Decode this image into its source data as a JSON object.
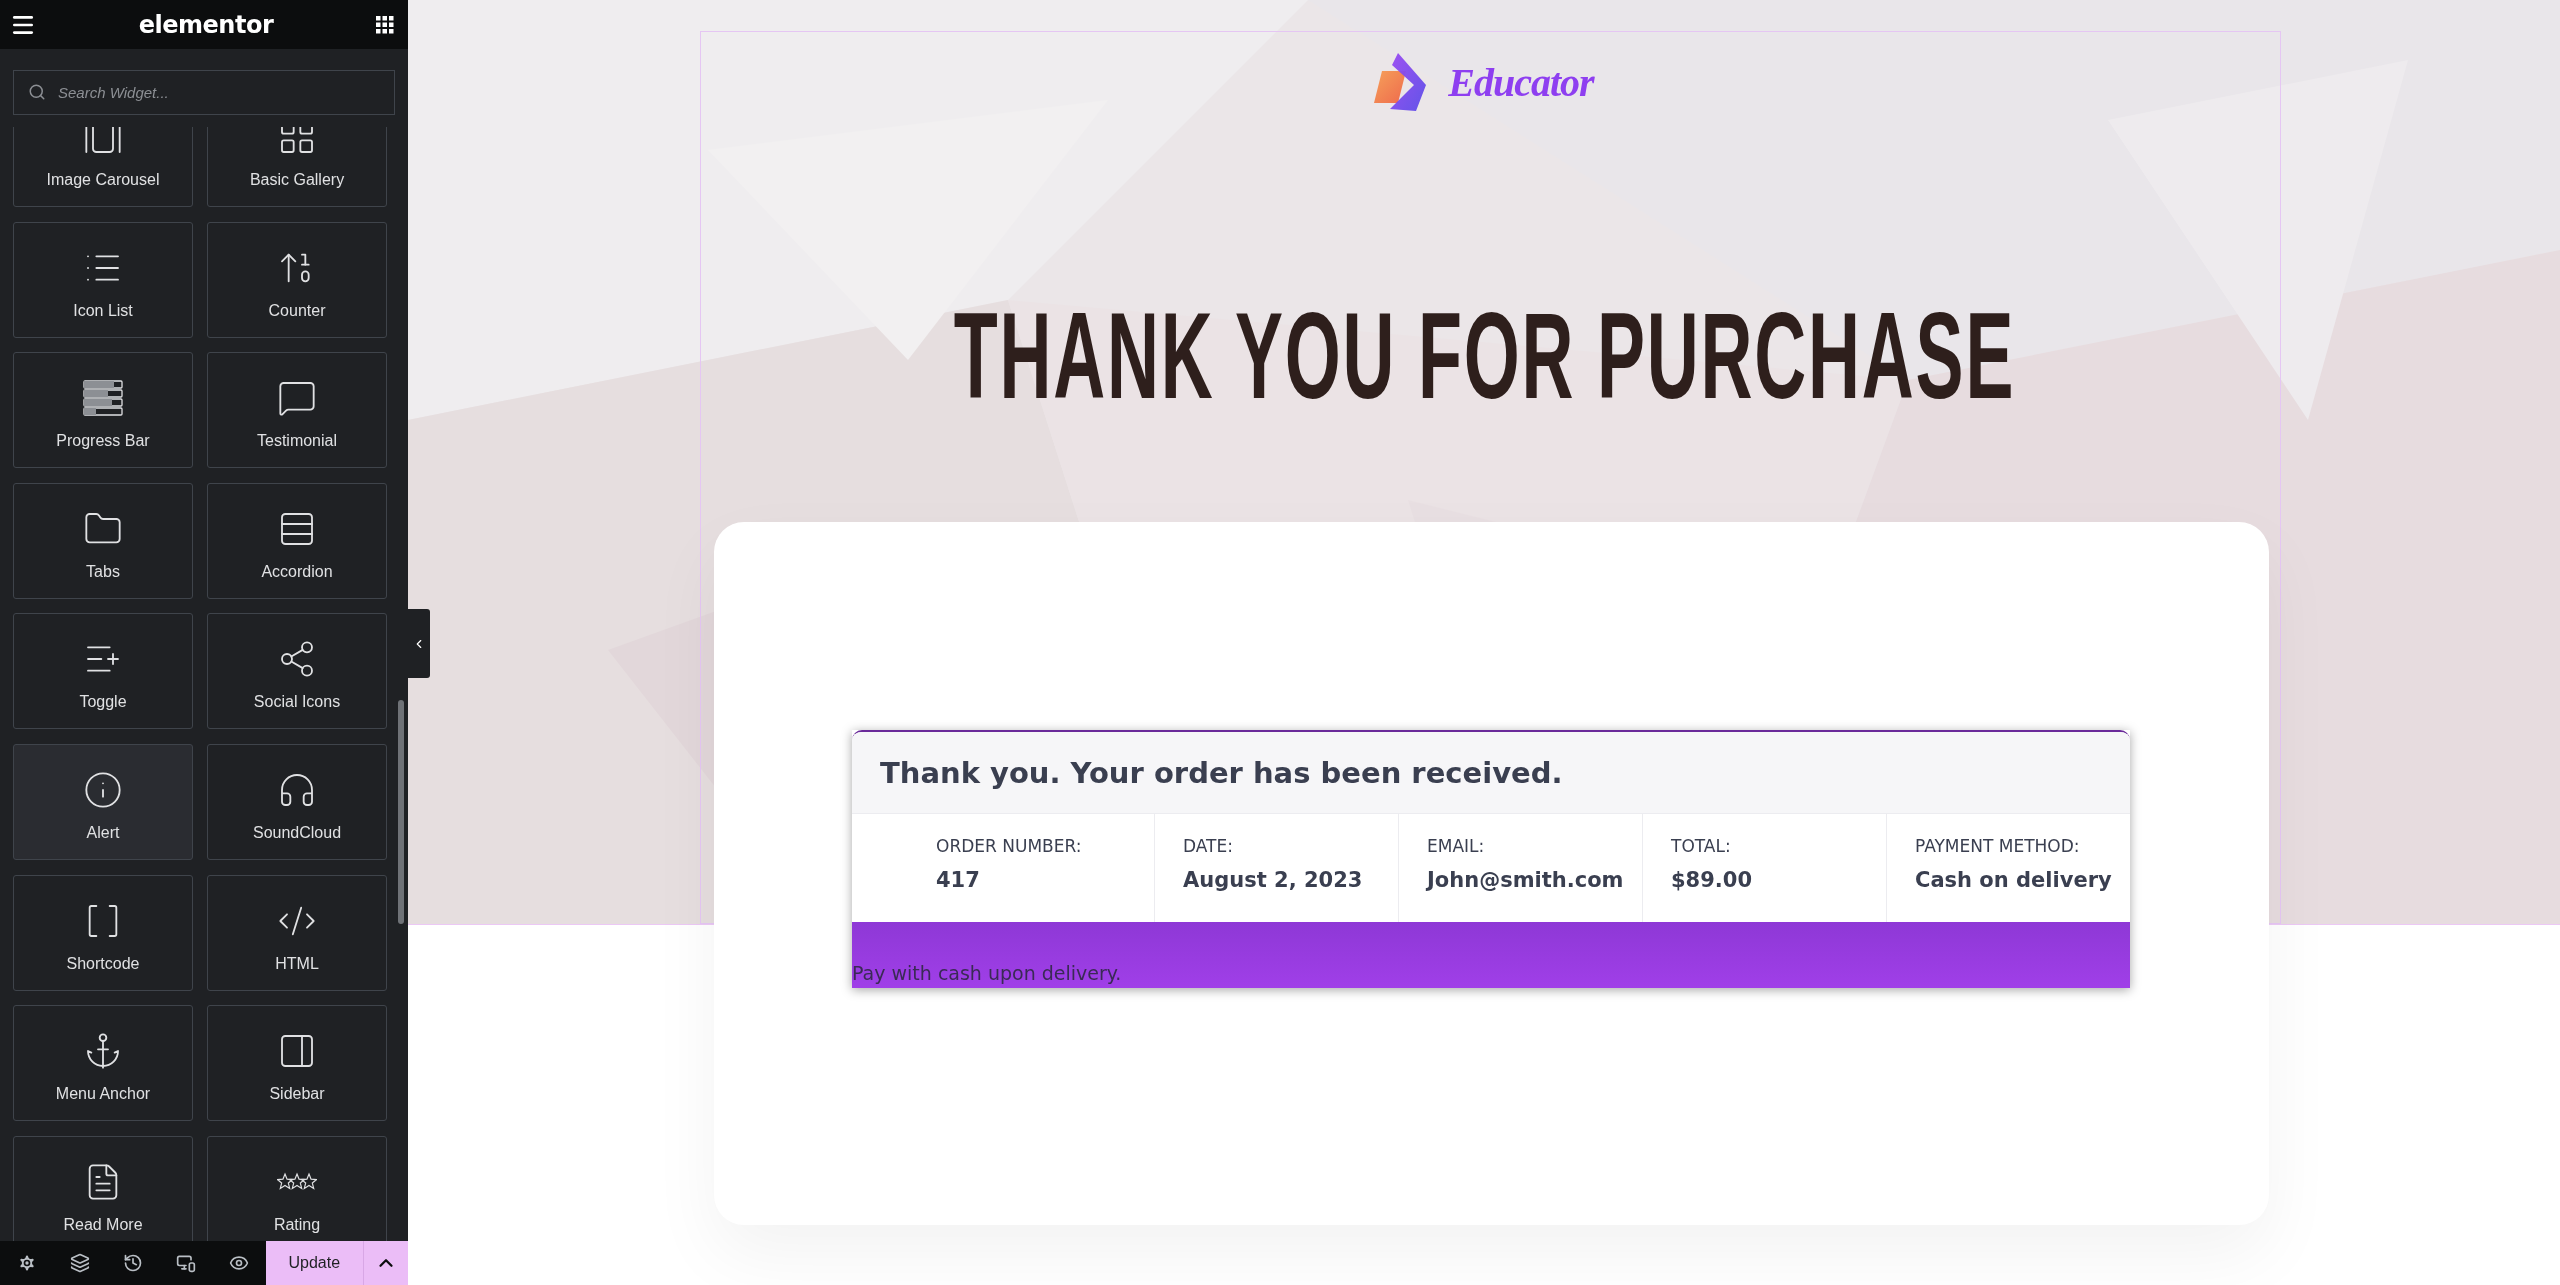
{
  "editor_panel": {
    "title": "elementor",
    "search": {
      "placeholder": "Search Widget..."
    },
    "widgets": [
      {
        "label": "Image Carousel",
        "selected": false
      },
      {
        "label": "Basic Gallery",
        "selected": false
      },
      {
        "label": "Icon List",
        "selected": false
      },
      {
        "label": "Counter",
        "selected": false
      },
      {
        "label": "Progress Bar",
        "selected": false
      },
      {
        "label": "Testimonial",
        "selected": false
      },
      {
        "label": "Tabs",
        "selected": false
      },
      {
        "label": "Accordion",
        "selected": false
      },
      {
        "label": "Toggle",
        "selected": false
      },
      {
        "label": "Social Icons",
        "selected": false
      },
      {
        "label": "Alert",
        "selected": true
      },
      {
        "label": "SoundCloud",
        "selected": false
      },
      {
        "label": "Shortcode",
        "selected": false
      },
      {
        "label": "HTML",
        "selected": false
      },
      {
        "label": "Menu Anchor",
        "selected": false
      },
      {
        "label": "Sidebar",
        "selected": false
      },
      {
        "label": "Read More",
        "selected": false
      },
      {
        "label": "Rating",
        "selected": false
      }
    ],
    "footer": {
      "update_button": "Update"
    }
  },
  "page": {
    "logo": {
      "text": "Educator"
    },
    "heading": "THANK YOU FOR PURCHASE",
    "order": {
      "title": "Thank you. Your order has been received.",
      "details": [
        {
          "label": "ORDER NUMBER:",
          "value": "417"
        },
        {
          "label": "DATE:",
          "value": "August 2, 2023"
        },
        {
          "label": "EMAIL:",
          "value": "John@smith.com"
        },
        {
          "label": "TOTAL:",
          "value": "$89.00"
        },
        {
          "label": "PAYMENT METHOD:",
          "value": "Cash on delivery"
        }
      ],
      "payment_note": "Pay with cash upon delivery."
    }
  }
}
